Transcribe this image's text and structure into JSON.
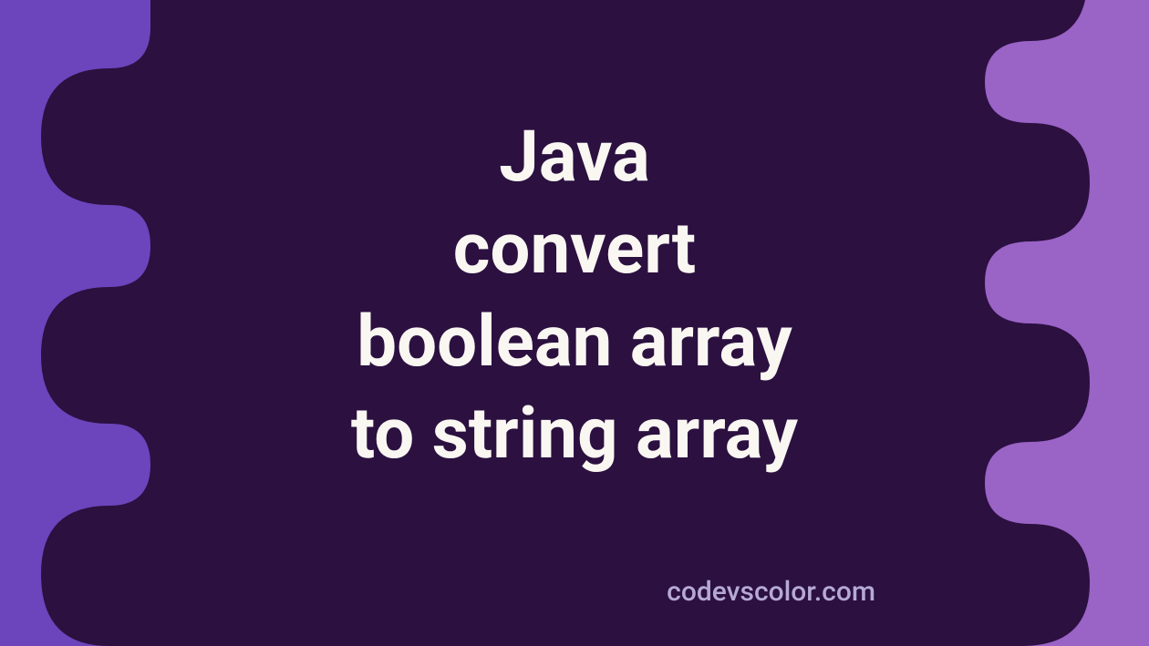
{
  "title": "Java\nconvert\nboolean array\nto string array",
  "credit": "codevscolor.com",
  "colors": {
    "bg_left": "#6C44BC",
    "bg_right": "#9A63C6",
    "blob": "#2B1040",
    "title": "#FAF7F2",
    "credit": "#B6A9D5"
  }
}
